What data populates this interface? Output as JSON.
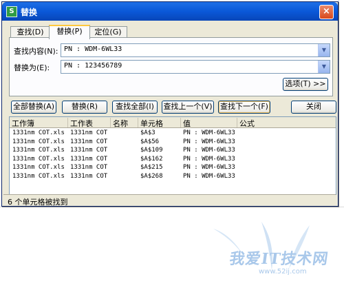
{
  "window": {
    "title": "替换",
    "app_icon": "S",
    "close": "×"
  },
  "tabs": [
    {
      "label": "查找(D)"
    },
    {
      "label": "替换(P)"
    },
    {
      "label": "定位(G)"
    }
  ],
  "find": {
    "label": "查找内容(N):",
    "value": "PN : WDM-6WL33"
  },
  "replace": {
    "label": "替换为(E):",
    "value": "PN : 123456789"
  },
  "buttons": {
    "options": "选项(T) >>",
    "replace_all": "全部替换(A)",
    "replace": "替换(R)",
    "find_all": "查找全部(I)",
    "find_prev": "查找上一个(V)",
    "find_next": "查找下一个(F)",
    "close": "关闭"
  },
  "results": {
    "columns": [
      "工作簿",
      "工作表",
      "名称",
      "单元格",
      "值",
      "公式"
    ],
    "rows": [
      [
        "1331nm COT.xls",
        "1331nm COT",
        "",
        "$A$3",
        "PN : WDM-6WL33",
        ""
      ],
      [
        "1331nm COT.xls",
        "1331nm COT",
        "",
        "$A$56",
        "PN : WDM-6WL33",
        ""
      ],
      [
        "1331nm COT.xls",
        "1331nm COT",
        "",
        "$A$109",
        "PN : WDM-6WL33",
        ""
      ],
      [
        "1331nm COT.xls",
        "1331nm COT",
        "",
        "$A$162",
        "PN : WDM-6WL33",
        ""
      ],
      [
        "1331nm COT.xls",
        "1331nm COT",
        "",
        "$A$215",
        "PN : WDM-6WL33",
        ""
      ],
      [
        "1331nm COT.xls",
        "1331nm COT",
        "",
        "$A$268",
        "PN : WDM-6WL33",
        ""
      ]
    ]
  },
  "status": "6 个单元格被找到",
  "watermark": {
    "text": "我爱IT技术网",
    "url": "www.52ij.com"
  },
  "colors": {
    "titlebar": "#0a58d8",
    "dialog_bg": "#ece9d8",
    "tab_accent": "#ffc83c"
  }
}
